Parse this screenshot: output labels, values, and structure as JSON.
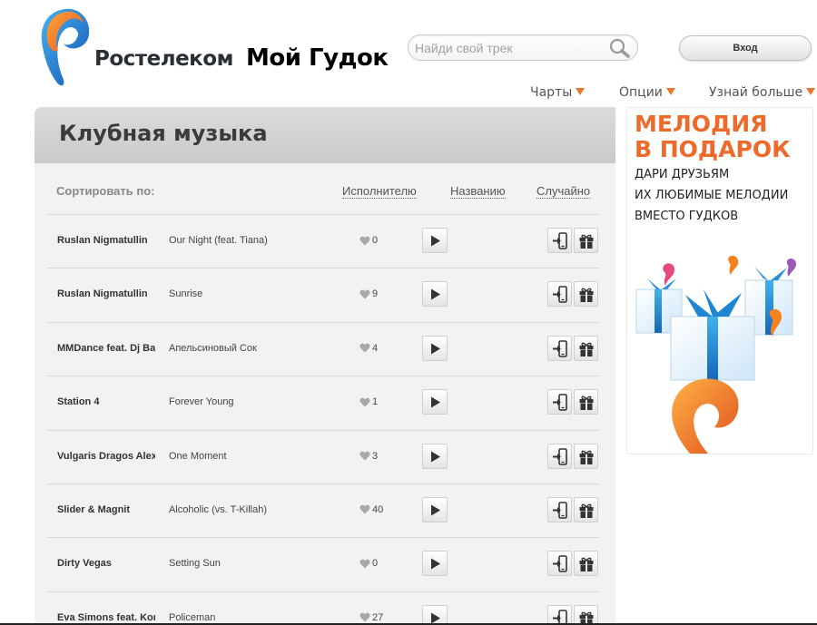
{
  "header": {
    "brand": "Ростелеком",
    "product": "Мой Гудок",
    "search_placeholder": "Найди свой трек",
    "login_label": "Вход"
  },
  "nav": [
    {
      "label": "Чарты"
    },
    {
      "label": "Опции"
    },
    {
      "label": "Узнай больше"
    }
  ],
  "main": {
    "title": "Клубная музыка",
    "sort_label": "Сортировать по:",
    "sort_options": [
      "Исполнителю",
      "Названию",
      "Случайно"
    ]
  },
  "tracks": [
    {
      "artist": "Ruslan Nigmatullin",
      "title": "Our Night (feat. Tiana)",
      "likes": "0"
    },
    {
      "artist": "Ruslan Nigmatullin",
      "title": "Sunrise",
      "likes": "9"
    },
    {
      "artist": "MMDance feat. Dj Ba",
      "title": "Апельсиновый Сок",
      "likes": "4"
    },
    {
      "artist": "Station 4",
      "title": "Forever Young",
      "likes": "1"
    },
    {
      "artist": "Vulgaris Dragos Alex",
      "title": "One Moment",
      "likes": "3"
    },
    {
      "artist": "Slider & Magnit",
      "title": "Alcoholic (vs. T-Killah)",
      "likes": "40"
    },
    {
      "artist": "Dirty Vegas",
      "title": "Setting Sun",
      "likes": "0"
    },
    {
      "artist": "Eva Simons feat. Kon",
      "title": "Policeman",
      "likes": "27"
    }
  ],
  "promo": {
    "headline_1": "МЕЛОДИЯ",
    "headline_2": "В ПОДАРОК",
    "line_1": "ДАРИ ДРУЗЬЯМ",
    "line_2": "ИХ ЛЮБИМЫЕ МЕЛОДИИ",
    "line_3": "ВМЕСТО ГУДКОВ"
  },
  "colors": {
    "accent_orange": "#e8772e",
    "promo_orange": "#ee6a2a",
    "logo_blue": "#1e78c8",
    "logo_orange": "#f47a20"
  },
  "icons": {
    "search": "magnifier-icon",
    "like": "heart-icon",
    "play": "play-icon",
    "set": "set-ringtone-icon",
    "gift": "gift-icon",
    "dropdown": "triangle-down-icon"
  }
}
